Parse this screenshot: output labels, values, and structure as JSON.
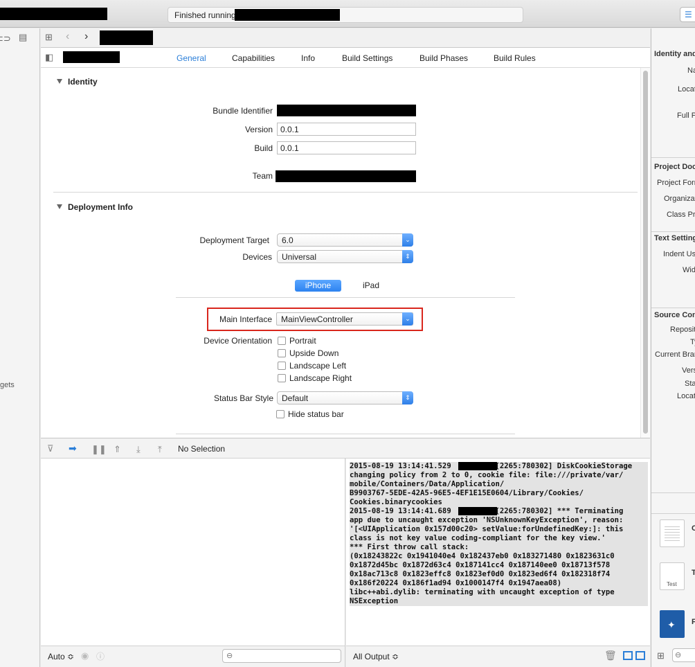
{
  "toolbar": {
    "status_text": "Finished running"
  },
  "navigator": {
    "partial_label": "gets"
  },
  "tabs": [
    {
      "label": "General",
      "active": true
    },
    {
      "label": "Capabilities"
    },
    {
      "label": "Info"
    },
    {
      "label": "Build Settings"
    },
    {
      "label": "Build Phases"
    },
    {
      "label": "Build Rules"
    }
  ],
  "identity": {
    "title": "Identity",
    "bundle_identifier_label": "Bundle Identifier",
    "version_label": "Version",
    "version_value": "0.0.1",
    "build_label": "Build",
    "build_value": "0.0.1",
    "team_label": "Team"
  },
  "deployment": {
    "title": "Deployment Info",
    "target_label": "Deployment Target",
    "target_value": "6.0",
    "devices_label": "Devices",
    "devices_value": "Universal",
    "segment_iphone": "iPhone",
    "segment_ipad": "iPad",
    "main_interface_label": "Main Interface",
    "main_interface_value": "MainViewController",
    "orientation_label": "Device Orientation",
    "orientations": [
      "Portrait",
      "Upside Down",
      "Landscape Left",
      "Landscape Right"
    ],
    "status_bar_label": "Status Bar Style",
    "status_bar_value": "Default",
    "hide_status_bar": "Hide status bar"
  },
  "debug": {
    "no_selection": "No Selection",
    "auto_label": "Auto ≎",
    "all_output_label": "All Output ≎"
  },
  "console": {
    "text": "2015-08-19 13:14:41.529          [2265:780302] DiskCookieStorage\nchanging policy from 2 to 0, cookie file: file:///private/var/\nmobile/Containers/Data/Application/\nB9903767-5EDE-42A5-96E5-4EF1E15E0604/Library/Cookies/\nCookies.binarycookies\n2015-08-19 13:14:41.689          [2265:780302] *** Terminating\napp due to uncaught exception 'NSUnknownKeyException', reason:\n'[<UIApplication 0x157d00c20> setValue:forUndefinedKey:]: this\nclass is not key value coding-compliant for the key view.'\n*** First throw call stack:\n(0x18243822c 0x1941040e4 0x182437eb0 0x183271480 0x1823631c0\n0x1872d45bc 0x1872d63c4 0x187141cc4 0x187140ee0 0x18713f578\n0x18ac713c8 0x1823effc8 0x1823ef0d0 0x1823ed6f4 0x182318f74\n0x186f20224 0x186f1ad94 0x1000147f4 0x1947aea08)\nlibc++abi.dylib: terminating with uncaught exception of type\nNSException"
  },
  "inspector": {
    "sections": [
      {
        "title": "Identity and",
        "labels": [
          "Na",
          "Locat",
          "Full P"
        ]
      },
      {
        "title": "Project Doc",
        "labels": [
          "Project Form",
          "Organizat",
          "Class Pre"
        ]
      },
      {
        "title": "Text Setting",
        "labels": [
          "Indent Us",
          "Wid"
        ]
      },
      {
        "title": "Source Con",
        "labels": [
          "Reposit",
          "Ty",
          "Current Bran",
          "Vers",
          "Sta",
          "Locat"
        ]
      }
    ],
    "tile_labels": [
      "T",
      "Test",
      "F"
    ]
  },
  "colors": {
    "accent": "#2a7ed8",
    "highlight": "#d9261c"
  }
}
